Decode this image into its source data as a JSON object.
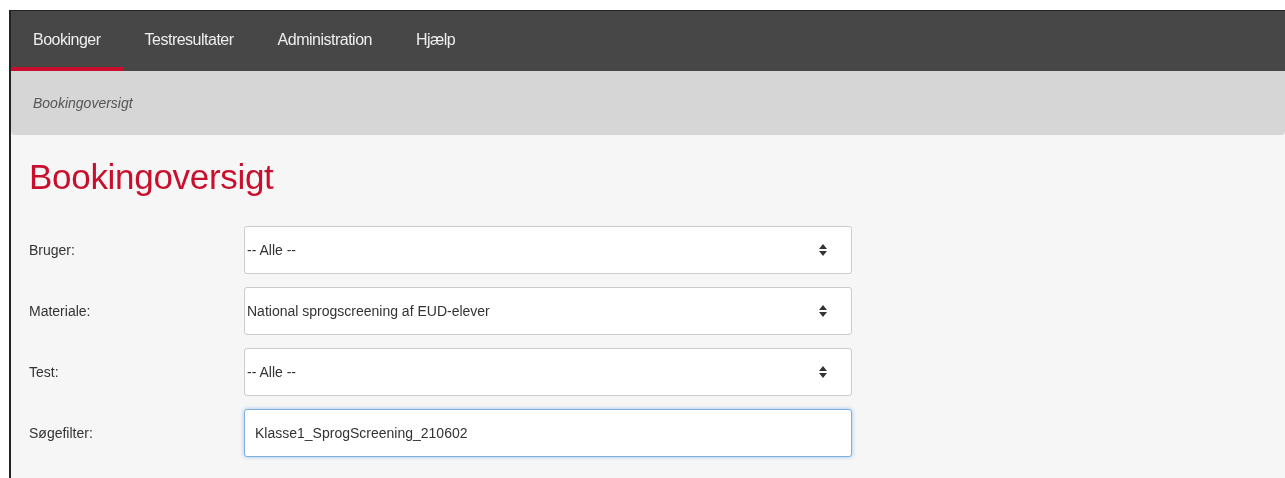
{
  "nav": {
    "tabs": [
      {
        "label": "Bookinger",
        "selected": true
      },
      {
        "label": "Testresultater",
        "selected": false
      },
      {
        "label": "Administration",
        "selected": false
      },
      {
        "label": "Hjælp",
        "selected": false
      }
    ]
  },
  "breadcrumb": "Bookingoversigt",
  "title": "Bookingoversigt",
  "form": [
    {
      "label": "Bruger:",
      "kind": "select",
      "value": "-- Alle --",
      "focused": false
    },
    {
      "label": "Materiale:",
      "kind": "select",
      "value": "National sprogscreening af EUD-elever",
      "focused": false
    },
    {
      "label": "Test:",
      "kind": "select",
      "value": "-- Alle --",
      "focused": false
    },
    {
      "label": "Søgefilter:",
      "kind": "text",
      "value": "Klasse1_SprogScreening_210602",
      "focused": true
    }
  ]
}
